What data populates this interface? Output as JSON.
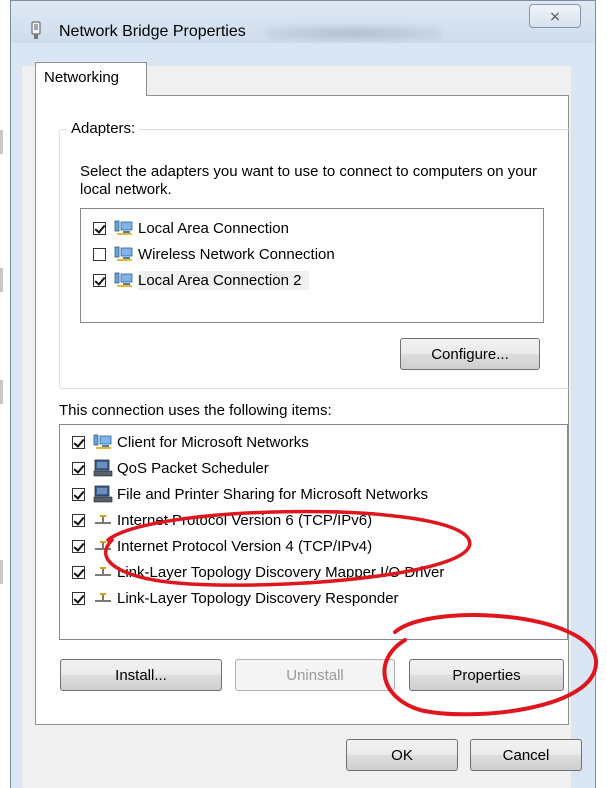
{
  "window": {
    "title": "Network Bridge Properties",
    "close_symbol": "⨯"
  },
  "tabs": [
    {
      "label": "Networking",
      "selected": true
    }
  ],
  "adapters": {
    "group_label": "Adapters:",
    "description": "Select the adapters you want to use to connect to computers on your local network.",
    "items": [
      {
        "label": "Local Area Connection",
        "checked": true,
        "icon": "network-adapter-icon"
      },
      {
        "label": "Wireless Network Connection",
        "checked": false,
        "icon": "network-adapter-icon"
      },
      {
        "label": "Local Area Connection 2",
        "checked": true,
        "icon": "network-adapter-icon",
        "selected": true
      }
    ],
    "configure_label": "Configure..."
  },
  "items_section": {
    "label": "This connection uses the following items:",
    "items": [
      {
        "label": "Client for Microsoft Networks",
        "checked": true,
        "icon": "network-client-icon"
      },
      {
        "label": "QoS Packet Scheduler",
        "checked": true,
        "icon": "service-icon"
      },
      {
        "label": "File and Printer Sharing for Microsoft Networks",
        "checked": true,
        "icon": "service-icon"
      },
      {
        "label": "Internet Protocol Version 6 (TCP/IPv6)",
        "checked": true,
        "icon": "protocol-icon"
      },
      {
        "label": "Internet Protocol Version 4 (TCP/IPv4)",
        "checked": true,
        "icon": "protocol-icon"
      },
      {
        "label": "Link-Layer Topology Discovery Mapper I/O Driver",
        "checked": true,
        "icon": "protocol-icon"
      },
      {
        "label": "Link-Layer Topology Discovery Responder",
        "checked": true,
        "icon": "protocol-icon"
      }
    ],
    "install_label": "Install...",
    "uninstall_label": "Uninstall",
    "properties_label": "Properties"
  },
  "footer": {
    "ok_label": "OK",
    "cancel_label": "Cancel"
  },
  "colors": {
    "annotation_red": "#e0161e",
    "frame": "#dae6f3",
    "selection": "#f0f0f0"
  }
}
